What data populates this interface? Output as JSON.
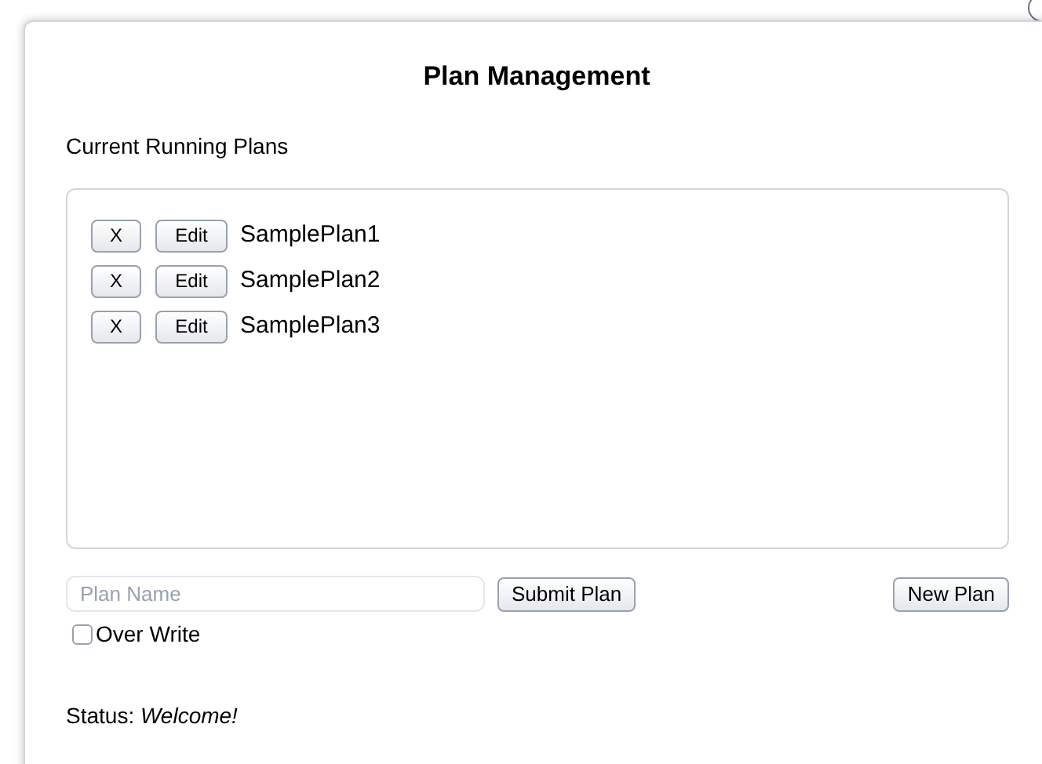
{
  "dialog": {
    "title": "Plan Management"
  },
  "plans_label": "Current Running Plans",
  "plans": [
    {
      "delete": "X",
      "edit": "Edit",
      "name": "SamplePlan1"
    },
    {
      "delete": "X",
      "edit": "Edit",
      "name": "SamplePlan2"
    },
    {
      "delete": "X",
      "edit": "Edit",
      "name": "SamplePlan3"
    }
  ],
  "plan_name": {
    "placeholder": "Plan Name"
  },
  "submit_button": "Submit Plan",
  "new_button": "New Plan",
  "overwrite": {
    "label": "Over Write",
    "checked": false
  },
  "status": "Status: *Welcome!*"
}
